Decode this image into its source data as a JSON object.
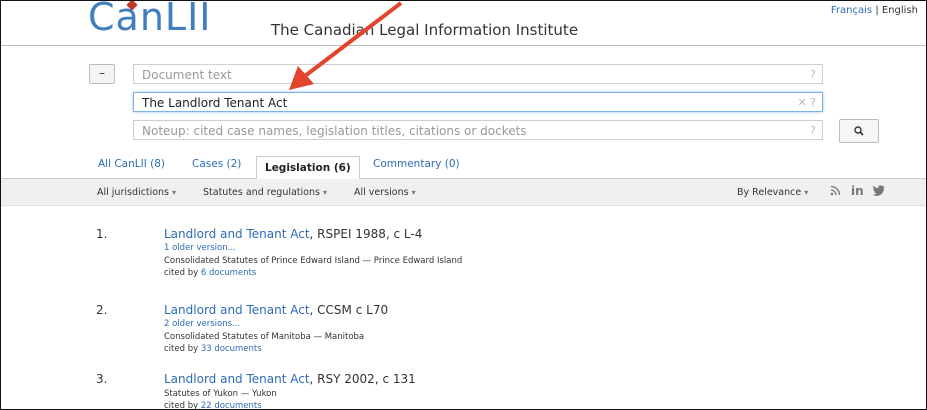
{
  "header": {
    "logo_text": "CanLII",
    "tagline": "The Canadian Legal Information Institute",
    "lang_fr": "Français",
    "lang_sep": "|",
    "lang_en": "English"
  },
  "search": {
    "collapse_label": "–",
    "document_text_placeholder": "Document text",
    "document_text_hint": "?",
    "title_value": "The Landlord Tenant Act",
    "title_hint": "✕ ?",
    "noteup_placeholder": "Noteup: cited case names, legislation titles, citations or dockets",
    "noteup_hint": "?",
    "search_button_icon": "search-icon"
  },
  "tabs": [
    {
      "label": "All CanLII (8)"
    },
    {
      "label": "Cases (2)"
    },
    {
      "label": "Legislation (6)"
    },
    {
      "label": "Commentary (0)"
    }
  ],
  "filters": {
    "jurisdictions": "All jurisdictions",
    "statutes": "Statutes and regulations",
    "versions": "All versions",
    "sort": "By Relevance",
    "caret": "▾"
  },
  "social": {
    "rss": "⌇",
    "linkedin": "in",
    "twitter": "🐦"
  },
  "results": [
    {
      "rank": "1.",
      "title": "Landlord and Tenant Act",
      "citation": ", RSPEI 1988, c L-4",
      "older": "1 older version...",
      "source": "Consolidated Statutes of Prince Edward Island — Prince Edward Island",
      "cited_prefix": "cited by",
      "cited_link": "6 documents"
    },
    {
      "rank": "2.",
      "title": "Landlord and Tenant Act",
      "citation": ", CCSM c L70",
      "older": "2 older versions...",
      "source": "Consolidated Statutes of Manitoba — Manitoba",
      "cited_prefix": "cited by",
      "cited_link": "33 documents"
    },
    {
      "rank": "3.",
      "title": "Landlord and Tenant Act",
      "citation": ", RSY 2002, c 131",
      "source": "Statutes of Yukon — Yukon",
      "cited_prefix": "cited by",
      "cited_link": "22 documents"
    }
  ],
  "colors": {
    "link": "#2d6db5",
    "arrow": "#e2452c"
  }
}
